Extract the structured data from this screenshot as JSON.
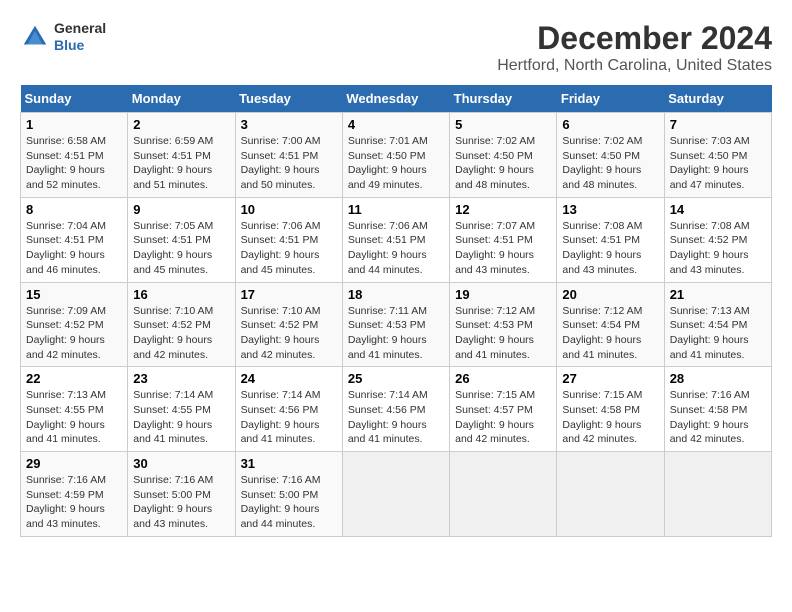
{
  "header": {
    "logo_line1": "General",
    "logo_line2": "Blue",
    "title": "December 2024",
    "subtitle": "Hertford, North Carolina, United States"
  },
  "days_of_week": [
    "Sunday",
    "Monday",
    "Tuesday",
    "Wednesday",
    "Thursday",
    "Friday",
    "Saturday"
  ],
  "weeks": [
    [
      {
        "day": "1",
        "sunrise": "6:58 AM",
        "sunset": "4:51 PM",
        "daylight": "9 hours and 52 minutes."
      },
      {
        "day": "2",
        "sunrise": "6:59 AM",
        "sunset": "4:51 PM",
        "daylight": "9 hours and 51 minutes."
      },
      {
        "day": "3",
        "sunrise": "7:00 AM",
        "sunset": "4:51 PM",
        "daylight": "9 hours and 50 minutes."
      },
      {
        "day": "4",
        "sunrise": "7:01 AM",
        "sunset": "4:50 PM",
        "daylight": "9 hours and 49 minutes."
      },
      {
        "day": "5",
        "sunrise": "7:02 AM",
        "sunset": "4:50 PM",
        "daylight": "9 hours and 48 minutes."
      },
      {
        "day": "6",
        "sunrise": "7:02 AM",
        "sunset": "4:50 PM",
        "daylight": "9 hours and 48 minutes."
      },
      {
        "day": "7",
        "sunrise": "7:03 AM",
        "sunset": "4:50 PM",
        "daylight": "9 hours and 47 minutes."
      }
    ],
    [
      {
        "day": "8",
        "sunrise": "7:04 AM",
        "sunset": "4:51 PM",
        "daylight": "9 hours and 46 minutes."
      },
      {
        "day": "9",
        "sunrise": "7:05 AM",
        "sunset": "4:51 PM",
        "daylight": "9 hours and 45 minutes."
      },
      {
        "day": "10",
        "sunrise": "7:06 AM",
        "sunset": "4:51 PM",
        "daylight": "9 hours and 45 minutes."
      },
      {
        "day": "11",
        "sunrise": "7:06 AM",
        "sunset": "4:51 PM",
        "daylight": "9 hours and 44 minutes."
      },
      {
        "day": "12",
        "sunrise": "7:07 AM",
        "sunset": "4:51 PM",
        "daylight": "9 hours and 43 minutes."
      },
      {
        "day": "13",
        "sunrise": "7:08 AM",
        "sunset": "4:51 PM",
        "daylight": "9 hours and 43 minutes."
      },
      {
        "day": "14",
        "sunrise": "7:08 AM",
        "sunset": "4:52 PM",
        "daylight": "9 hours and 43 minutes."
      }
    ],
    [
      {
        "day": "15",
        "sunrise": "7:09 AM",
        "sunset": "4:52 PM",
        "daylight": "9 hours and 42 minutes."
      },
      {
        "day": "16",
        "sunrise": "7:10 AM",
        "sunset": "4:52 PM",
        "daylight": "9 hours and 42 minutes."
      },
      {
        "day": "17",
        "sunrise": "7:10 AM",
        "sunset": "4:52 PM",
        "daylight": "9 hours and 42 minutes."
      },
      {
        "day": "18",
        "sunrise": "7:11 AM",
        "sunset": "4:53 PM",
        "daylight": "9 hours and 41 minutes."
      },
      {
        "day": "19",
        "sunrise": "7:12 AM",
        "sunset": "4:53 PM",
        "daylight": "9 hours and 41 minutes."
      },
      {
        "day": "20",
        "sunrise": "7:12 AM",
        "sunset": "4:54 PM",
        "daylight": "9 hours and 41 minutes."
      },
      {
        "day": "21",
        "sunrise": "7:13 AM",
        "sunset": "4:54 PM",
        "daylight": "9 hours and 41 minutes."
      }
    ],
    [
      {
        "day": "22",
        "sunrise": "7:13 AM",
        "sunset": "4:55 PM",
        "daylight": "9 hours and 41 minutes."
      },
      {
        "day": "23",
        "sunrise": "7:14 AM",
        "sunset": "4:55 PM",
        "daylight": "9 hours and 41 minutes."
      },
      {
        "day": "24",
        "sunrise": "7:14 AM",
        "sunset": "4:56 PM",
        "daylight": "9 hours and 41 minutes."
      },
      {
        "day": "25",
        "sunrise": "7:14 AM",
        "sunset": "4:56 PM",
        "daylight": "9 hours and 41 minutes."
      },
      {
        "day": "26",
        "sunrise": "7:15 AM",
        "sunset": "4:57 PM",
        "daylight": "9 hours and 42 minutes."
      },
      {
        "day": "27",
        "sunrise": "7:15 AM",
        "sunset": "4:58 PM",
        "daylight": "9 hours and 42 minutes."
      },
      {
        "day": "28",
        "sunrise": "7:16 AM",
        "sunset": "4:58 PM",
        "daylight": "9 hours and 42 minutes."
      }
    ],
    [
      {
        "day": "29",
        "sunrise": "7:16 AM",
        "sunset": "4:59 PM",
        "daylight": "9 hours and 43 minutes."
      },
      {
        "day": "30",
        "sunrise": "7:16 AM",
        "sunset": "5:00 PM",
        "daylight": "9 hours and 43 minutes."
      },
      {
        "day": "31",
        "sunrise": "7:16 AM",
        "sunset": "5:00 PM",
        "daylight": "9 hours and 44 minutes."
      },
      null,
      null,
      null,
      null
    ]
  ]
}
